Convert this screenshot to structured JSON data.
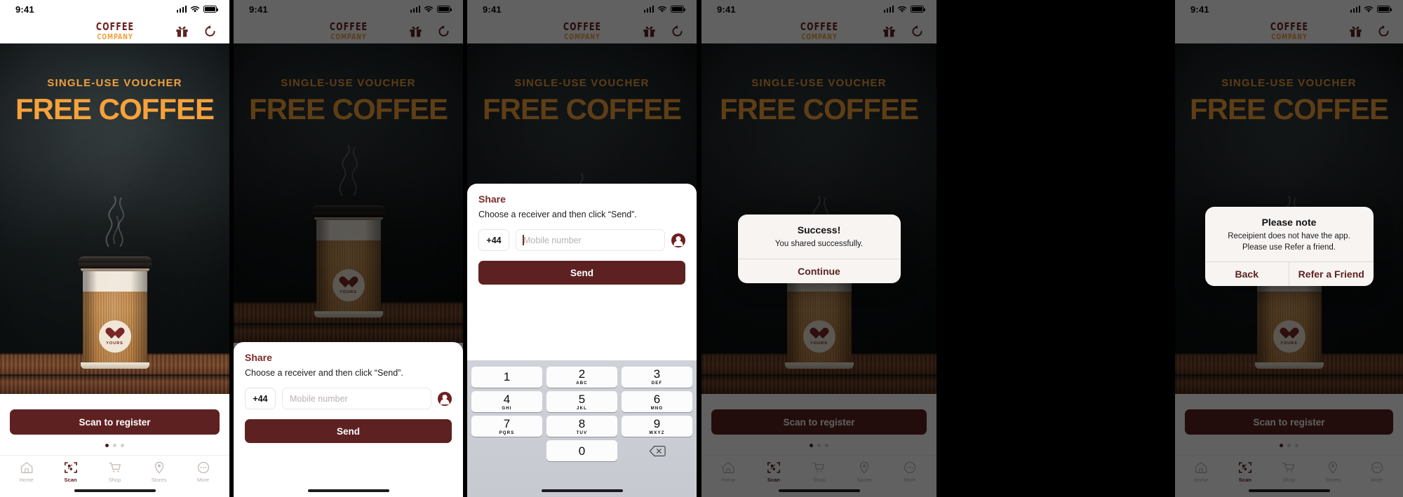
{
  "status_bar": {
    "time": "9:41",
    "signal_icon": "signal-bars-icon",
    "wifi_icon": "wifi-icon",
    "battery_icon": "battery-icon"
  },
  "header": {
    "logo_line1": "COFFEE",
    "logo_line2": "COMPANY",
    "gift_icon": "gift-icon",
    "refresh_icon": "refresh-icon"
  },
  "hero": {
    "voucher_label": "SINGLE-USE VOUCHER",
    "voucher_title": "FREE COFFEE",
    "cup_badge_text": "YOURS",
    "cup_badge_icon": "heart-icon"
  },
  "cta": {
    "label": "Scan to register"
  },
  "pagination": {
    "total": 3,
    "active_index": 0
  },
  "tabbar": {
    "items": [
      {
        "label": "Home",
        "icon": "home-icon",
        "active": false
      },
      {
        "label": "Scan",
        "icon": "qr-scan-icon",
        "active": true
      },
      {
        "label": "Shop",
        "icon": "cart-icon",
        "active": false
      },
      {
        "label": "Stores",
        "icon": "pin-icon",
        "active": false
      },
      {
        "label": "More",
        "icon": "ellipsis-icon",
        "active": false
      }
    ]
  },
  "share_sheet": {
    "title": "Share",
    "subtitle": "Choose a receiver and then click “Send”.",
    "country_code": "+44",
    "mobile_placeholder": "Mobile number",
    "mobile_value": "",
    "contact_icon": "contact-person-icon",
    "send_label": "Send"
  },
  "keypad": {
    "keys": [
      {
        "num": "1",
        "alpha": ""
      },
      {
        "num": "2",
        "alpha": "ABC"
      },
      {
        "num": "3",
        "alpha": "DEF"
      },
      {
        "num": "4",
        "alpha": "GHI"
      },
      {
        "num": "5",
        "alpha": "JKL"
      },
      {
        "num": "6",
        "alpha": "MNO"
      },
      {
        "num": "7",
        "alpha": "PQRS"
      },
      {
        "num": "8",
        "alpha": "TUV"
      },
      {
        "num": "9",
        "alpha": "WXYZ"
      },
      {
        "num": "0",
        "alpha": ""
      }
    ],
    "delete_icon": "backspace-icon"
  },
  "success_alert": {
    "title": "Success!",
    "message": "You shared successfully.",
    "primary_label": "Continue"
  },
  "note_alert": {
    "title": "Please note",
    "message": "Receipient does not have the app.\nPlease use Refer a friend.",
    "message_line1": "Receipient does not have the app.",
    "message_line2": "Please use Refer a friend.",
    "back_label": "Back",
    "refer_label": "Refer a Friend"
  },
  "colors": {
    "brand_maroon": "#5E2121",
    "brand_orange": "#F2A03D",
    "logo_maroon": "#6E2020",
    "sheet_title": "#7B2B2B"
  }
}
